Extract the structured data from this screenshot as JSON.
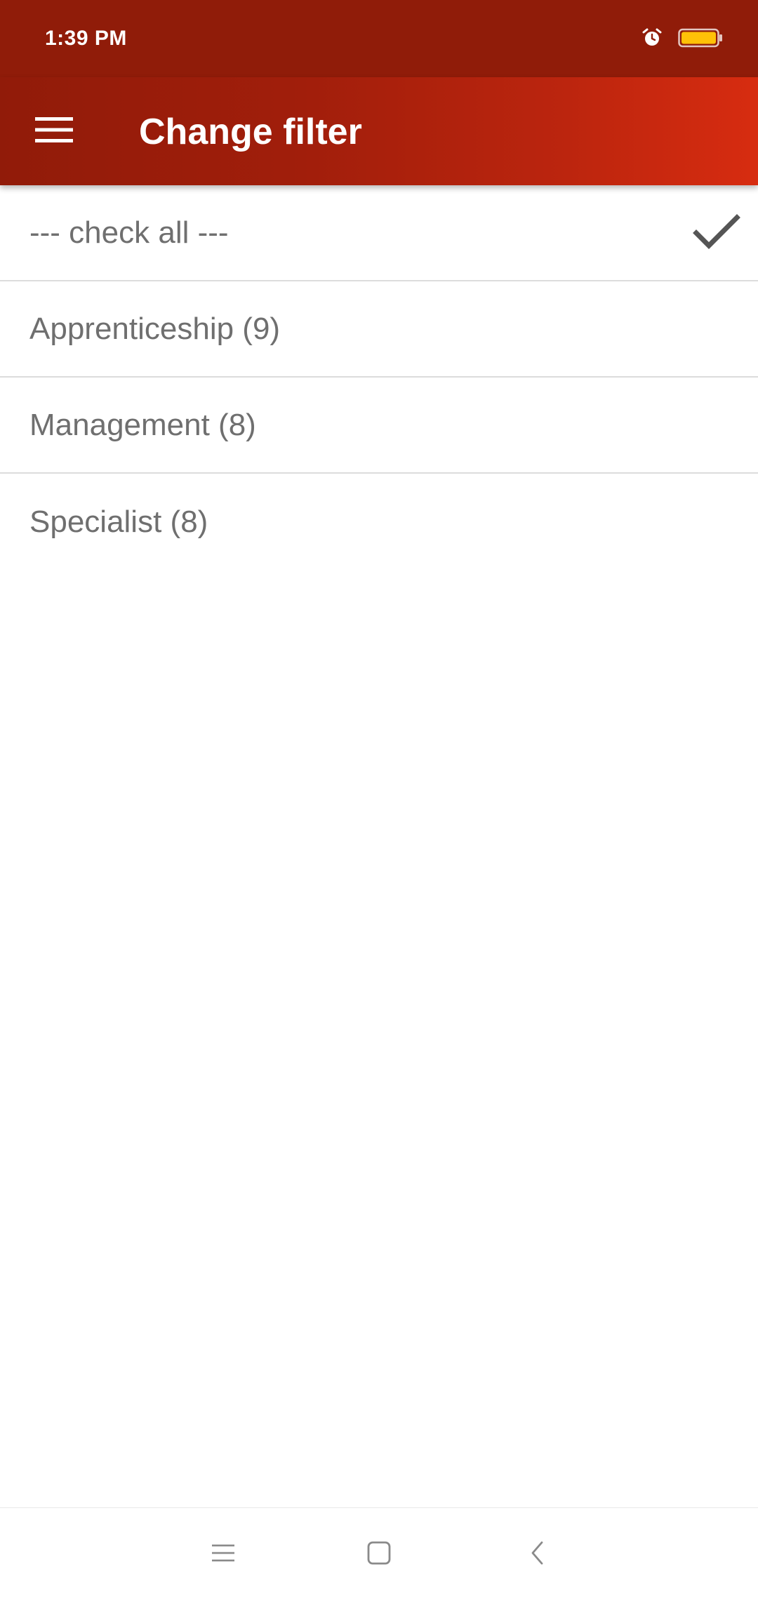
{
  "status_bar": {
    "time": "1:39 PM",
    "icons": [
      "alarm-icon",
      "battery-icon"
    ],
    "battery_color": "#ffc107"
  },
  "app_bar": {
    "title": "Change filter",
    "menu_icon": "hamburger-menu-icon",
    "gradient_colors": [
      "#911b09",
      "#d72c10"
    ]
  },
  "filters": {
    "check_all": {
      "label": "--- check all ---",
      "checked": true
    },
    "items": [
      {
        "label": "Apprenticeship (9)",
        "checked": false
      },
      {
        "label": "Management (8)",
        "checked": false
      },
      {
        "label": "Specialist (8)",
        "checked": false
      }
    ]
  },
  "nav_bar": {
    "buttons": [
      "recent-apps-icon",
      "home-icon",
      "back-icon"
    ]
  },
  "colors": {
    "status_bar_bg": "#901c09",
    "text_secondary": "#6f6f6f",
    "divider": "#dcdcdc",
    "check_color": "#555555"
  }
}
